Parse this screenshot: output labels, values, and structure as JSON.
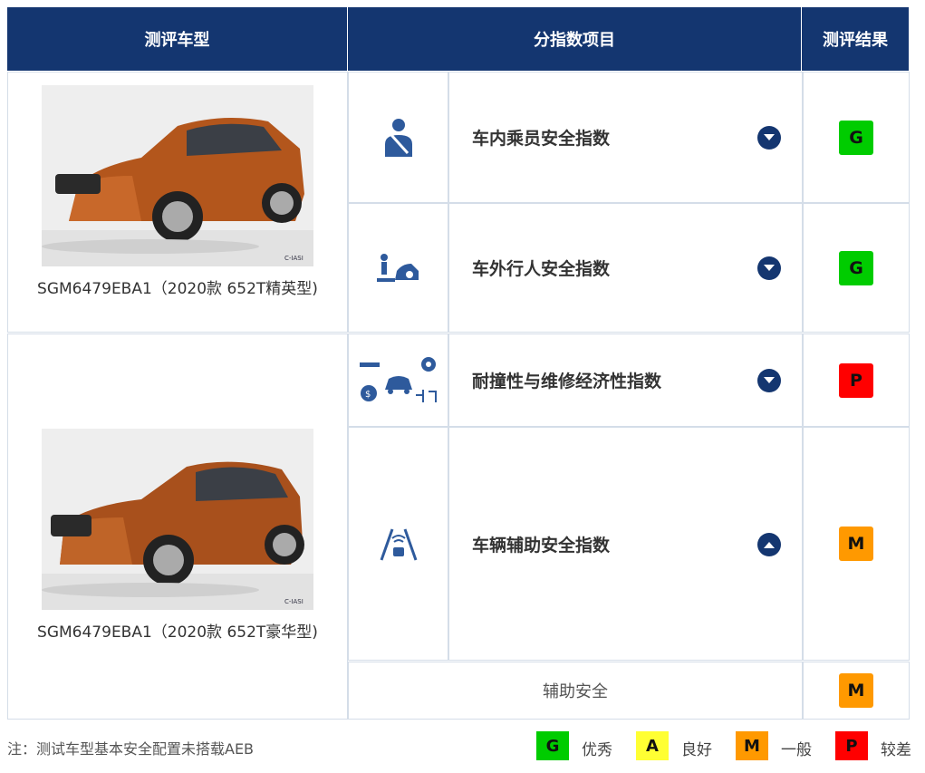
{
  "header": {
    "col_model": "测评车型",
    "col_index": "分指数项目",
    "col_result": "测评结果"
  },
  "models": [
    {
      "caption": "SGM6479EBA1（2020款 652T精英型)",
      "image_alt": "orange SUV photo"
    },
    {
      "caption": "SGM6479EBA1（2020款 652T豪华型)",
      "image_alt": "orange SUV photo"
    }
  ],
  "rows": [
    {
      "label": "车内乘员安全指数",
      "icon": "seatbelt-occupant-icon",
      "toggle": "expand",
      "rating": "G",
      "color": "#00cc00"
    },
    {
      "label": "车外行人安全指数",
      "icon": "pedestrian-icon",
      "toggle": "expand",
      "rating": "G",
      "color": "#00cc00"
    },
    {
      "label": "耐撞性与维修经济性指数",
      "icon": "repair-economy-icon",
      "toggle": "expand",
      "rating": "P",
      "color": "#ff0000"
    },
    {
      "label": "车辆辅助安全指数",
      "icon": "driver-assist-icon",
      "toggle": "collapse",
      "rating": "M",
      "color": "#ff9900"
    }
  ],
  "subrow": {
    "label": "辅助安全",
    "rating": "M",
    "color": "#ff9900"
  },
  "footer": {
    "note": "注：测试车型基本安全配置未搭载AEB",
    "legend": [
      {
        "rating": "G",
        "text": "优秀",
        "color": "#00cc00"
      },
      {
        "rating": "A",
        "text": "良好",
        "color": "#ffff33"
      },
      {
        "rating": "M",
        "text": "一般",
        "color": "#ff9900"
      },
      {
        "rating": "P",
        "text": "较差",
        "color": "#ff0000"
      }
    ]
  }
}
